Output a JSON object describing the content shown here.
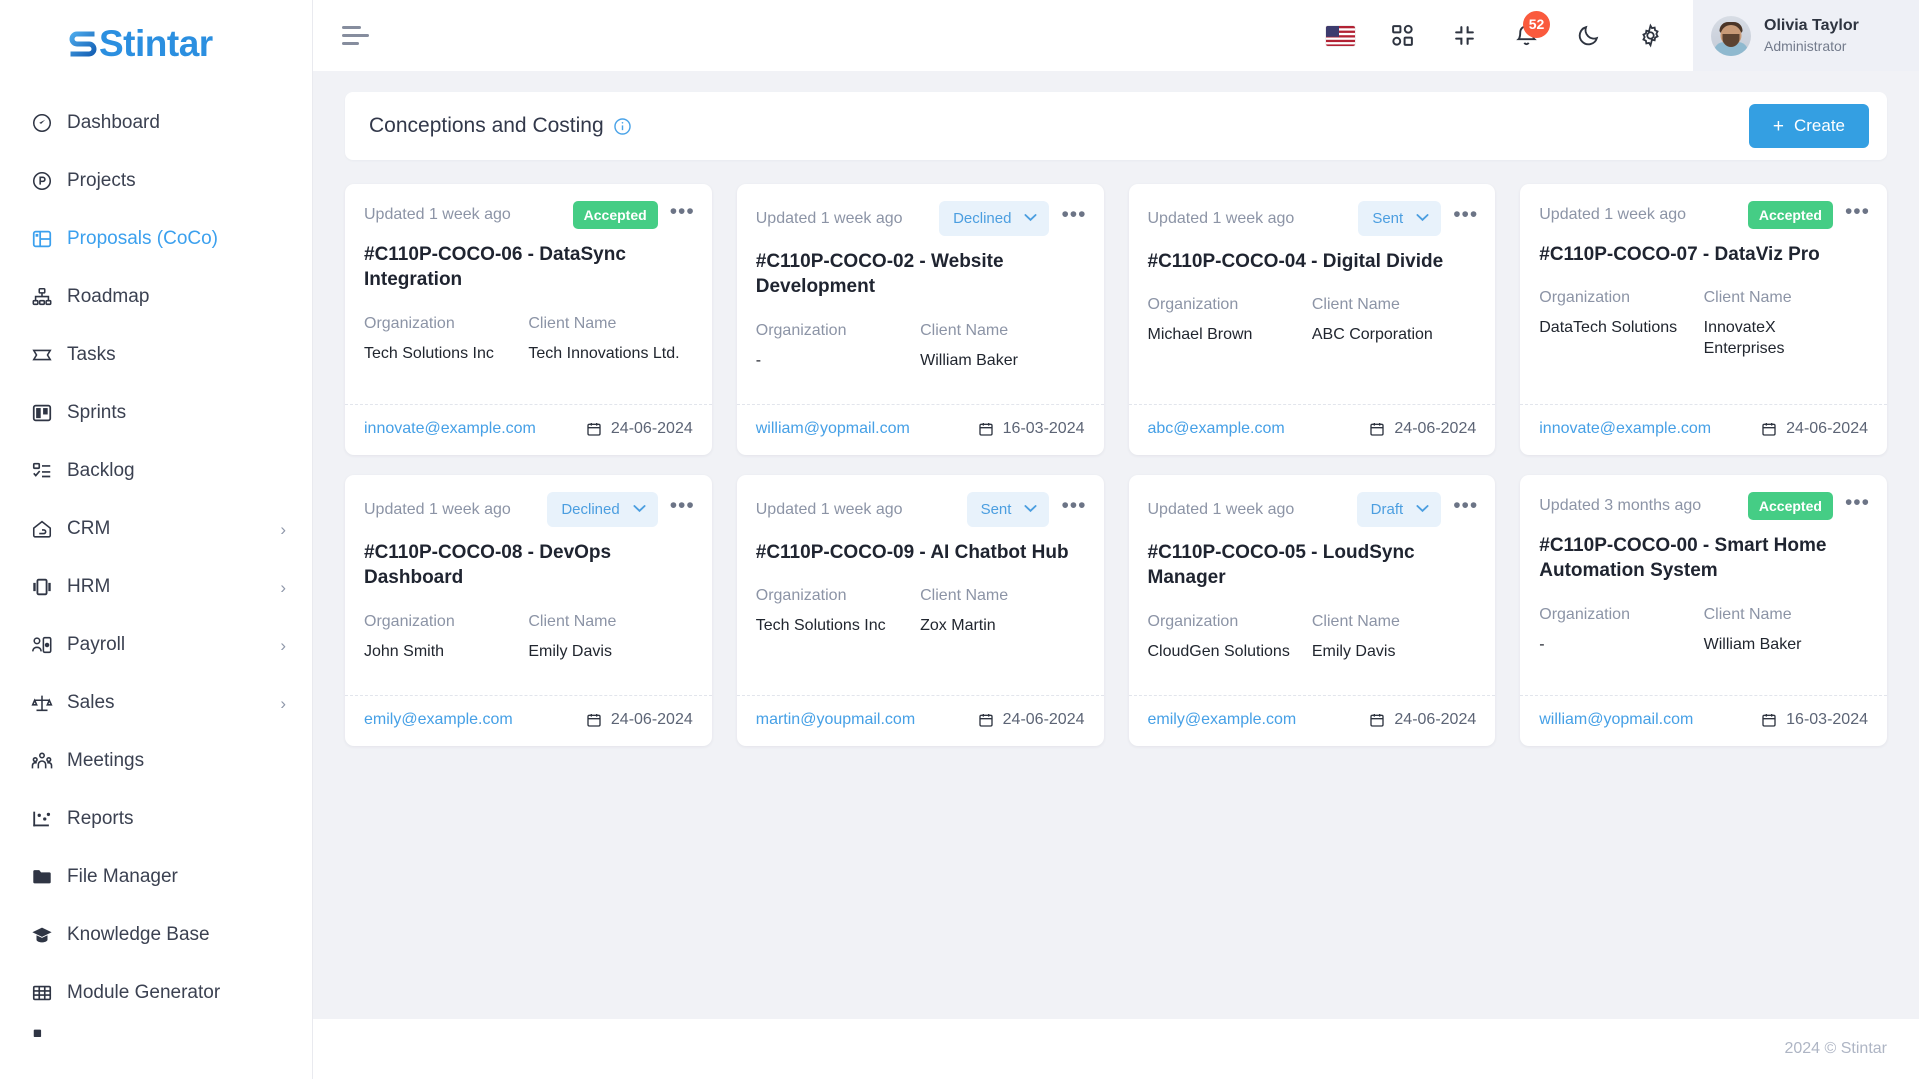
{
  "brand": {
    "name": "Stintar"
  },
  "sidebar": {
    "items": [
      {
        "label": "Dashboard",
        "icon": "dashboard-icon",
        "active": false,
        "expandable": false
      },
      {
        "label": "Projects",
        "icon": "projects-icon",
        "active": false,
        "expandable": false
      },
      {
        "label": "Proposals (CoCo)",
        "icon": "proposals-icon",
        "active": true,
        "expandable": false
      },
      {
        "label": "Roadmap",
        "icon": "roadmap-icon",
        "active": false,
        "expandable": false
      },
      {
        "label": "Tasks",
        "icon": "tasks-icon",
        "active": false,
        "expandable": false
      },
      {
        "label": "Sprints",
        "icon": "sprints-icon",
        "active": false,
        "expandable": false
      },
      {
        "label": "Backlog",
        "icon": "backlog-icon",
        "active": false,
        "expandable": false
      },
      {
        "label": "CRM",
        "icon": "crm-icon",
        "active": false,
        "expandable": true
      },
      {
        "label": "HRM",
        "icon": "hrm-icon",
        "active": false,
        "expandable": true
      },
      {
        "label": "Payroll",
        "icon": "payroll-icon",
        "active": false,
        "expandable": true
      },
      {
        "label": "Sales",
        "icon": "sales-icon",
        "active": false,
        "expandable": true
      },
      {
        "label": "Meetings",
        "icon": "meetings-icon",
        "active": false,
        "expandable": false
      },
      {
        "label": "Reports",
        "icon": "reports-icon",
        "active": false,
        "expandable": false
      },
      {
        "label": "File Manager",
        "icon": "folder-icon",
        "active": false,
        "expandable": false
      },
      {
        "label": "Knowledge Base",
        "icon": "graduation-cap-icon",
        "active": false,
        "expandable": false
      },
      {
        "label": "Module Generator",
        "icon": "grid-table-icon",
        "active": false,
        "expandable": false
      }
    ]
  },
  "topbar": {
    "menu_toggle": "hamburger-icon",
    "icons": [
      {
        "name": "language-flag-icon",
        "label": "US"
      },
      {
        "name": "apps-grid-icon",
        "label": "Apps"
      },
      {
        "name": "fullscreen-collapse-icon",
        "label": "Compress"
      },
      {
        "name": "notification-bell-icon",
        "label": "Notifications",
        "badge": "52"
      },
      {
        "name": "dark-mode-moon-icon",
        "label": "Dark mode"
      },
      {
        "name": "settings-gear-icon",
        "label": "Settings"
      }
    ],
    "notification_count": "52",
    "user": {
      "name": "Olivia Taylor",
      "role": "Administrator"
    }
  },
  "page": {
    "title": "Conceptions and Costing",
    "info_icon": "info-circle-icon",
    "create_label": "Create",
    "create_plus": "+"
  },
  "labels": {
    "organization": "Organization",
    "client_name": "Client Name",
    "more_options": "•••",
    "chevron": "▾"
  },
  "colors": {
    "accent": "#349fe2",
    "accepted_badge_bg": "#45cd85",
    "select_badge_bg": "#e8f2fb",
    "select_badge_text": "#4b9ee0",
    "notification_badge": "#fa5a3d",
    "link": "#46a0e6"
  },
  "cards": [
    {
      "updated": "Updated 1 week ago",
      "status": "Accepted",
      "status_type": "pill",
      "title": "#C110P-COCO-06 - DataSync Integration",
      "organization": "Tech Solutions Inc",
      "client_name": "Tech Innovations Ltd.",
      "email": "innovate@example.com",
      "date": "24-06-2024"
    },
    {
      "updated": "Updated 1 week ago",
      "status": "Declined",
      "status_type": "select",
      "title": "#C110P-COCO-02 - Website Development",
      "organization": "-",
      "client_name": "William Baker",
      "email": "william@yopmail.com",
      "date": "16-03-2024"
    },
    {
      "updated": "Updated 1 week ago",
      "status": "Sent",
      "status_type": "select",
      "title": "#C110P-COCO-04 - Digital Divide",
      "organization": "Michael Brown",
      "client_name": "ABC Corporation",
      "email": "abc@example.com",
      "date": "24-06-2024"
    },
    {
      "updated": "Updated 1 week ago",
      "status": "Accepted",
      "status_type": "pill",
      "title": "#C110P-COCO-07 - DataViz Pro",
      "organization": "DataTech Solutions",
      "client_name": "InnovateX Enterprises",
      "email": "innovate@example.com",
      "date": "24-06-2024"
    },
    {
      "updated": "Updated 1 week ago",
      "status": "Declined",
      "status_type": "select",
      "title": "#C110P-COCO-08 - DevOps Dashboard",
      "organization": "John Smith",
      "client_name": "Emily Davis",
      "email": "emily@example.com",
      "date": "24-06-2024"
    },
    {
      "updated": "Updated 1 week ago",
      "status": "Sent",
      "status_type": "select",
      "title": "#C110P-COCO-09 - AI Chatbot Hub",
      "organization": "Tech Solutions Inc",
      "client_name": "Zox Martin",
      "email": "martin@youpmail.com",
      "date": "24-06-2024"
    },
    {
      "updated": "Updated 1 week ago",
      "status": "Draft",
      "status_type": "select",
      "title": "#C110P-COCO-05 - LoudSync Manager",
      "organization": "CloudGen Solutions",
      "client_name": "Emily Davis",
      "email": "emily@example.com",
      "date": "24-06-2024"
    },
    {
      "updated": "Updated 3 months ago",
      "status": "Accepted",
      "status_type": "pill",
      "title": "#C110P-COCO-00 - Smart Home Automation System",
      "organization": "-",
      "client_name": "William Baker",
      "email": "william@yopmail.com",
      "date": "16-03-2024"
    }
  ],
  "footer": {
    "copyright": "2024 © Stintar"
  }
}
